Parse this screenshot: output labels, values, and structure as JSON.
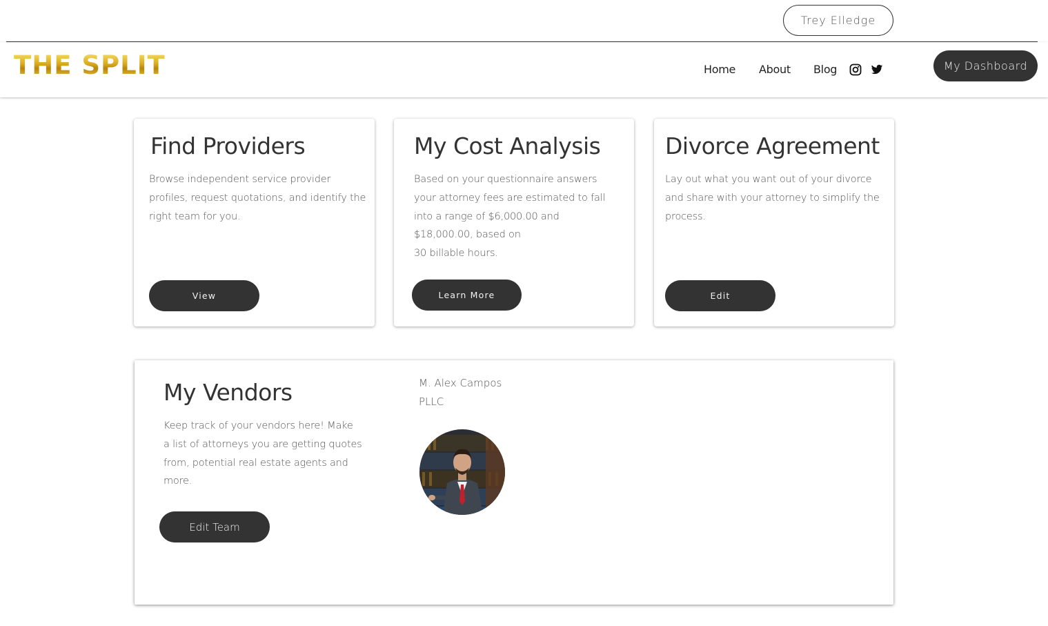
{
  "user": {
    "name": "Trey Elledge"
  },
  "brand": {
    "logo_text": "THE SPLIT",
    "gold": "#d9a820"
  },
  "nav": {
    "items": [
      "Home",
      "About",
      "Blog"
    ],
    "social": [
      "instagram-icon",
      "twitter-icon"
    ]
  },
  "header": {
    "dashboard_label": "My Dashboard"
  },
  "cards": {
    "find_providers": {
      "title": "Find Providers",
      "text_lines": [
        "Browse independent service provider",
        "profiles, request quotations, and identify the",
        "right team for you."
      ],
      "button": "View"
    },
    "cost_analysis": {
      "title": "My Cost Analysis",
      "text_lines": [
        "Based on your questionnaire answers",
        "your attorney fees are estimated to fall",
        "into a range of $6,000.00 and",
        "$18,000.00, based on",
        "30 billable hours."
      ],
      "button": "Learn More"
    },
    "divorce_agreement": {
      "title": "Divorce Agreement",
      "text_lines": [
        "Lay out what you want out of your divorce",
        "and share with your attorney to simplify the",
        "process."
      ],
      "button": "Edit"
    }
  },
  "vendors": {
    "title": "My Vendors",
    "text_lines": [
      "Keep track of your vendors here! Make",
      "a list of attorneys you are getting quotes",
      "from, potential real estate agents and",
      "more."
    ],
    "button": "Edit Team",
    "vendor_name_lines": [
      "M. Alex Campos",
      "PLLC"
    ]
  },
  "colors": {
    "dark_button": "#333333",
    "text_gray": "#555555"
  }
}
